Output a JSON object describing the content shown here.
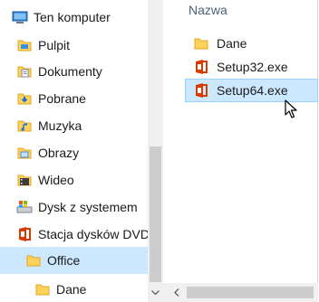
{
  "nav": {
    "items": [
      {
        "label": "Ten komputer",
        "icon": "computer-icon"
      },
      {
        "label": "Pulpit",
        "icon": "desktop-icon"
      },
      {
        "label": "Dokumenty",
        "icon": "documents-icon"
      },
      {
        "label": "Pobrane",
        "icon": "downloads-icon"
      },
      {
        "label": "Muzyka",
        "icon": "music-icon"
      },
      {
        "label": "Obrazy",
        "icon": "pictures-icon"
      },
      {
        "label": "Wideo",
        "icon": "videos-icon"
      },
      {
        "label": "Dysk z systemem",
        "icon": "system-drive-icon"
      },
      {
        "label": "Stacja dysków DVD",
        "icon": "dvd-drive-icon"
      },
      {
        "label": "Office",
        "icon": "folder-icon"
      },
      {
        "label": "Dane",
        "icon": "folder-icon"
      }
    ]
  },
  "content": {
    "column_header": "Nazwa",
    "files": [
      {
        "name": "Dane",
        "icon": "folder-icon"
      },
      {
        "name": "Setup32.exe",
        "icon": "office-setup-icon"
      },
      {
        "name": "Setup64.exe",
        "icon": "office-setup-icon"
      }
    ]
  },
  "colors": {
    "selection": "#cce8ff",
    "selection_border": "#99d1ff",
    "office_red": "#d83b01",
    "folder_yellow": "#ffd35b"
  }
}
